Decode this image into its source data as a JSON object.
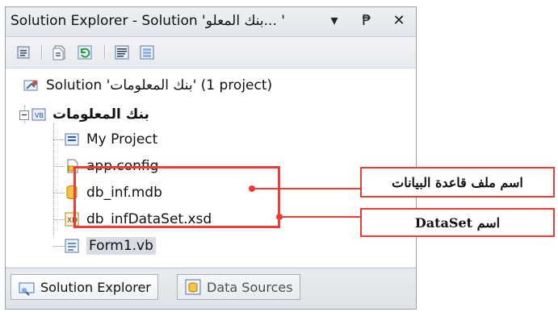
{
  "window": {
    "title": "Solution Explorer - Solution 'بنك المعلو... '",
    "controls": {
      "dropdown": "▾",
      "pin": "₱",
      "close": "✕"
    }
  },
  "toolbar": {
    "buttons": [
      {
        "icon": "properties-icon"
      },
      {
        "icon": "show-all-files-icon"
      },
      {
        "icon": "refresh-icon"
      },
      {
        "icon": "view-code-icon"
      },
      {
        "icon": "view-designer-icon"
      }
    ]
  },
  "tree": {
    "solution_label": "Solution 'بنك المعلومات' (1 project)",
    "project_label": "بنك المعلومات",
    "items": [
      {
        "label": "My Project",
        "icon": "my-project-icon"
      },
      {
        "label": "app.config",
        "icon": "config-file-icon"
      },
      {
        "label": "db_inf.mdb",
        "icon": "database-icon"
      },
      {
        "label": "db_infDataSet.xsd",
        "icon": "dataset-icon"
      },
      {
        "label": "Form1.vb",
        "icon": "form-icon"
      }
    ]
  },
  "tabs": {
    "items": [
      {
        "label": "Solution Explorer",
        "state": "active",
        "icon": "solution-explorer-icon"
      },
      {
        "label": "Data Sources",
        "state": "inactive",
        "icon": "data-sources-icon"
      }
    ]
  },
  "callouts": {
    "db_name": "اسم ملف قاعدة البيانات",
    "dataset_name": "اسم DataSet"
  },
  "colors": {
    "accent_red": "#ef3b35",
    "window_bg": "#eef0f3",
    "tree_bg": "#ffffff"
  }
}
